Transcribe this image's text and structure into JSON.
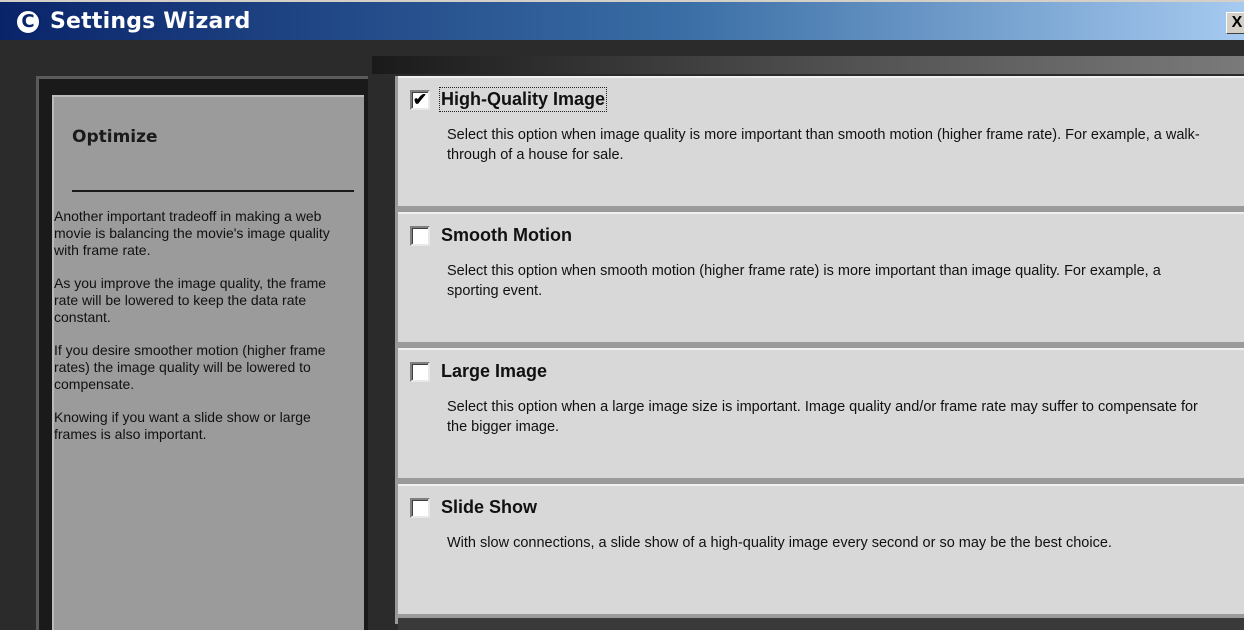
{
  "window": {
    "title": "Settings Wizard",
    "icon_letter": "C",
    "close_label": "X"
  },
  "sidebar": {
    "heading": "Optimize",
    "paragraphs": [
      "Another important tradeoff in making a web movie is balancing the movie's image quality with frame rate.",
      "As you improve the image quality, the frame rate will be lowered to keep the data rate constant.",
      "If you desire smoother motion (higher frame rates) the image quality will be lowered to compensate.",
      "Knowing if you want a slide show or large frames is also important."
    ]
  },
  "options": [
    {
      "title": "High-Quality Image",
      "checked": true,
      "description": "Select this option when image quality is more important than smooth motion (higher frame rate).  For example, a walk-through of a house for sale."
    },
    {
      "title": "Smooth Motion",
      "checked": false,
      "description": "Select this option when smooth motion (higher frame rate) is more important than image quality. For example, a sporting event."
    },
    {
      "title": "Large Image",
      "checked": false,
      "description": "Select this option when a large image size is important.  Image quality and/or frame rate may suffer to compensate for the bigger image."
    },
    {
      "title": "Slide Show",
      "checked": false,
      "description": "With slow connections, a slide show of a high-quality image every second or so may be the best choice."
    }
  ],
  "colors": {
    "titlebar_start": "#0a246a",
    "titlebar_end": "#a6caf0",
    "option_background": "#d8d8d8",
    "sidebar_background": "#9b9b9b"
  },
  "icons": [
    "app-logo-icon",
    "close-icon",
    "checkbox-check-icon"
  ]
}
